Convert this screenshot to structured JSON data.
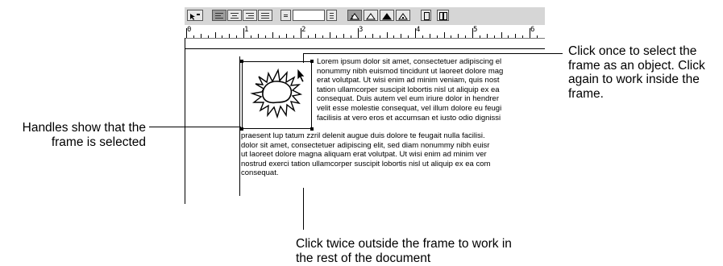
{
  "ruler": {
    "numbers": [
      "0",
      "1",
      "2",
      "3",
      "4",
      "5",
      "6"
    ]
  },
  "icons": {
    "frame_tool": "pointer-frame-icon",
    "align": [
      "align-left-icon",
      "align-center-icon",
      "align-right-icon",
      "justify-icon"
    ],
    "spacing": [
      "single-space-icon",
      "double-space-icon"
    ],
    "tabs": [
      "left-tab-icon",
      "center-tab-icon",
      "right-tab-icon",
      "decimal-tab-icon"
    ],
    "columns": [
      "one-column-icon",
      "two-column-icon"
    ],
    "cursor": "arrow-cursor-icon",
    "picture": "sun-picture-icon"
  },
  "document": {
    "wrap_lines": [
      "Lorem ipsum dolor sit amet, consectetuer adipiscing el",
      "nonummy nibh euismod tincidunt ut laoreet dolore mag",
      "erat volutpat.  Ut wisi enim ad minim veniam, quis nost",
      "tation ullamcorper suscipit lobortis nisl ut aliquip ex ea",
      "consequat.  Duis autem vel eum iriure dolor in hendrer",
      "velit esse molestie consequat, vel illum dolore eu feugi",
      "facilisis at vero eros et accumsan et iusto odio dignissi"
    ],
    "full_lines": [
      "praesent lup tatum zzril delenit augue duis dolore te feugait nulla facilisi.",
      "dolor sit amet, consectetuer adipiscing elit, sed diam nonummy nibh euisr",
      "ut laoreet dolore magna aliquam erat volutpat.  Ut wisi enim ad minim ver",
      "nostrud exerci tation ullamcorper suscipit lobortis nisl ut aliquip ex ea com",
      "consequat."
    ]
  },
  "callouts": {
    "select_frame": [
      "Click once to select the",
      "frame as an object. Click",
      "again to work inside the",
      "frame."
    ],
    "handles": [
      "Handles show that the",
      "frame is selected"
    ],
    "outside": [
      "Click twice outside the frame to work in",
      "the rest of the document"
    ]
  }
}
